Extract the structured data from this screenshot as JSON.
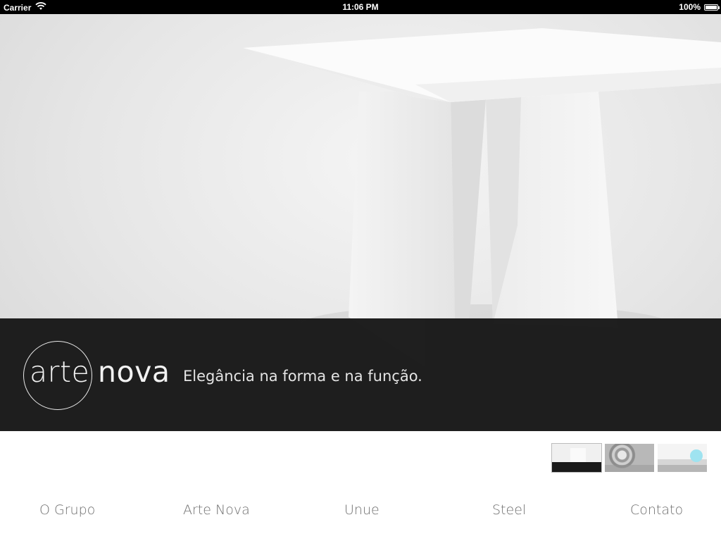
{
  "status_bar": {
    "carrier": "Carrier",
    "time": "11:06 PM",
    "battery": "100%"
  },
  "hero": {
    "logo_word_1": "arte",
    "logo_word_2": "nova",
    "tagline": "Elegância na forma e na função."
  },
  "thumbnails": [
    {
      "name": "thumb-table"
    },
    {
      "name": "thumb-disc"
    },
    {
      "name": "thumb-interior"
    }
  ],
  "nav": {
    "items": [
      "O Grupo",
      "Arte Nova",
      "Unue",
      "Steel",
      "Contato"
    ]
  },
  "colors": {
    "brand_bar": "#161616",
    "nav_text": "#6e6e6e",
    "status_bar": "#000000"
  }
}
